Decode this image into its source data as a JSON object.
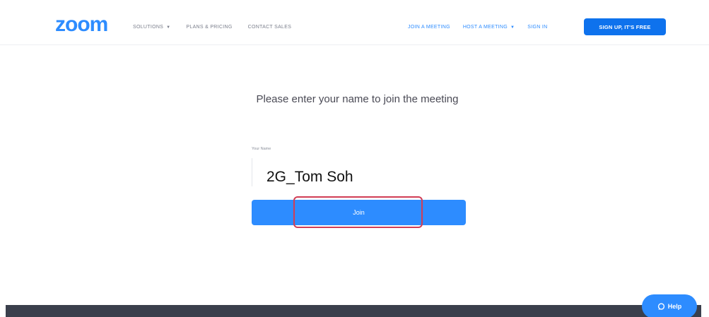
{
  "header": {
    "logo": "zoom",
    "nav_left": {
      "solutions": "SOLUTIONS",
      "plans": "PLANS & PRICING",
      "contact": "CONTACT SALES"
    },
    "nav_right": {
      "join": "JOIN A MEETING",
      "host": "HOST A MEETING",
      "signin": "SIGN IN"
    },
    "signup_label": "SIGN UP, IT'S FREE"
  },
  "main": {
    "prompt": "Please enter your name to join the meeting",
    "name_label": "Your Name",
    "name_value": "2G_Tom Soh",
    "join_label": "Join"
  },
  "help": {
    "label": "Help",
    "icon": "chat-bubble-icon"
  },
  "colors": {
    "brand": "#2d8cff",
    "button": "#0e72ed",
    "highlight": "#d13d55",
    "footer": "#3a3f4c"
  }
}
